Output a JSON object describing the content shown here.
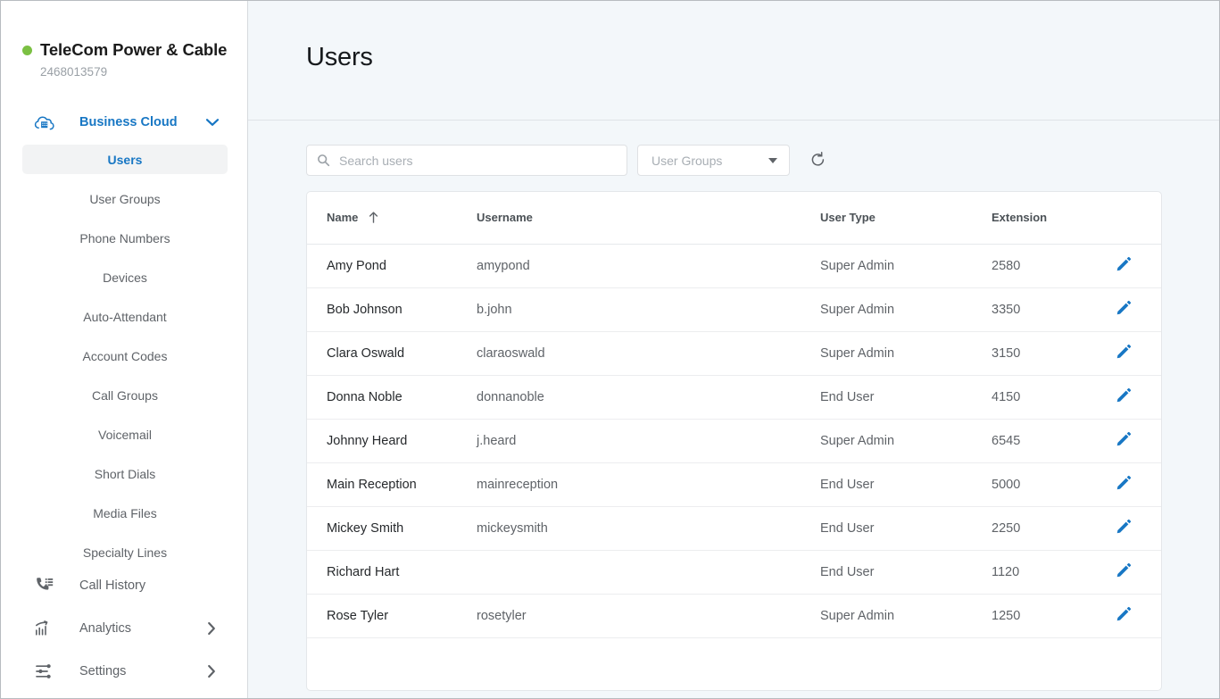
{
  "sidebar": {
    "org": {
      "status_dot_color": "#7bc043",
      "name": "TeleCom Power & Cable",
      "account_id": "2468013579"
    },
    "section": {
      "icon": "cloud-building-icon",
      "label": "Business Cloud",
      "caret": "chevron-down-icon"
    },
    "sub_items": [
      {
        "label": "Users",
        "active": true
      },
      {
        "label": "User Groups",
        "active": false
      },
      {
        "label": "Phone Numbers",
        "active": false
      },
      {
        "label": "Devices",
        "active": false
      },
      {
        "label": "Auto-Attendant",
        "active": false
      },
      {
        "label": "Account Codes",
        "active": false
      },
      {
        "label": "Call Groups",
        "active": false
      },
      {
        "label": "Voicemail",
        "active": false
      },
      {
        "label": "Short Dials",
        "active": false
      },
      {
        "label": "Media Files",
        "active": false
      },
      {
        "label": "Specialty Lines",
        "active": false
      }
    ],
    "main_items": [
      {
        "label": "Call History",
        "icon": "phone-list-icon",
        "has_caret": false
      },
      {
        "label": "Analytics",
        "icon": "chart-trend-icon",
        "has_caret": true
      },
      {
        "label": "Settings",
        "icon": "sliders-icon",
        "has_caret": true
      }
    ]
  },
  "header": {
    "title": "Users"
  },
  "toolbar": {
    "search": {
      "icon": "search-icon",
      "value": "",
      "placeholder": "Search users"
    },
    "user_groups_select": {
      "selected": "User Groups",
      "icon": "chevron-down-icon"
    },
    "refresh": {
      "icon": "refresh-icon",
      "label": "Refresh"
    }
  },
  "table": {
    "columns": [
      {
        "label": "Name",
        "sort": "asc",
        "sort_icon": "arrow-up-icon"
      },
      {
        "label": "Username",
        "sort": null
      },
      {
        "label": "User Type",
        "sort": null
      },
      {
        "label": "Extension",
        "sort": null
      },
      {
        "label": "",
        "sort": null
      }
    ],
    "row_action_icon": "pencil-icon",
    "rows": [
      {
        "name": "Amy Pond",
        "username": "amypond",
        "user_type": "Super Admin",
        "extension": "2580"
      },
      {
        "name": "Bob Johnson",
        "username": "b.john",
        "user_type": "Super Admin",
        "extension": "3350"
      },
      {
        "name": "Clara Oswald",
        "username": "claraoswald",
        "user_type": "Super Admin",
        "extension": "3150"
      },
      {
        "name": "Donna Noble",
        "username": "donnanoble",
        "user_type": "End User",
        "extension": "4150"
      },
      {
        "name": "Johnny Heard",
        "username": "j.heard",
        "user_type": "Super Admin",
        "extension": "6545"
      },
      {
        "name": "Main Reception",
        "username": "mainreception",
        "user_type": "End User",
        "extension": "5000"
      },
      {
        "name": "Mickey Smith",
        "username": "mickeysmith",
        "user_type": "End User",
        "extension": "2250"
      },
      {
        "name": "Richard Hart",
        "username": "",
        "user_type": "End User",
        "extension": "1120"
      },
      {
        "name": "Rose Tyler",
        "username": "rosetyler",
        "user_type": "Super Admin",
        "extension": "1250"
      }
    ]
  },
  "colors": {
    "accent_blue": "#1877c4",
    "status_green": "#7bc043",
    "page_bg": "#f3f7fa",
    "card_bg": "#ffffff",
    "text_muted": "#5f6368"
  }
}
